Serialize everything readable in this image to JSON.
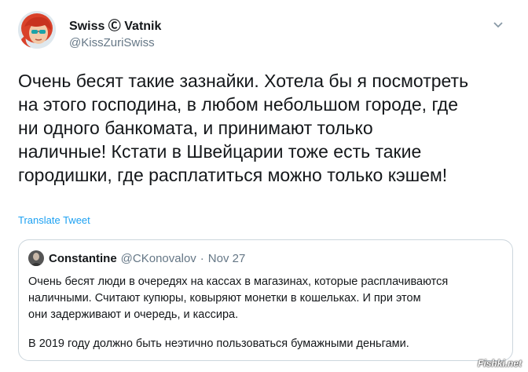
{
  "author": {
    "display_name": "Swiss Ⓒ Vatnik",
    "handle": "@KissZuriSwiss"
  },
  "tweet": {
    "text": "Очень бесят такие зазнайки. Хотела бы я посмотреть\nна этого господина, в любом небольшом городе, где\nни одного банкомата, и принимают только\nналичные! Кстати в Швейцарии тоже есть такие\nгородишки, где расплатиться можно только кэшем!",
    "translate_label": "Translate Tweet"
  },
  "quoted": {
    "name": "Constantine",
    "handle": "@CKonovalov",
    "separator": "·",
    "date": "Nov 27",
    "text": "Очень бесят люди в очередях на кассах в магазинах, которые расплачиваются\nналичными. Считают купюры, ковыряют монетки в кошельках. И при этом\nони задерживают и очередь, и кассира.",
    "text2": "В 2019 году должно быть неэтично пользоваться бумажными деньгами."
  },
  "watermark": "Fishki.net",
  "icons": [
    "avatar-redhead",
    "chevron-down-icon",
    "quoted-avatar"
  ],
  "colors": {
    "link": "#1da1f2",
    "secondary_text": "#657786",
    "border": "#ccd6dd"
  }
}
